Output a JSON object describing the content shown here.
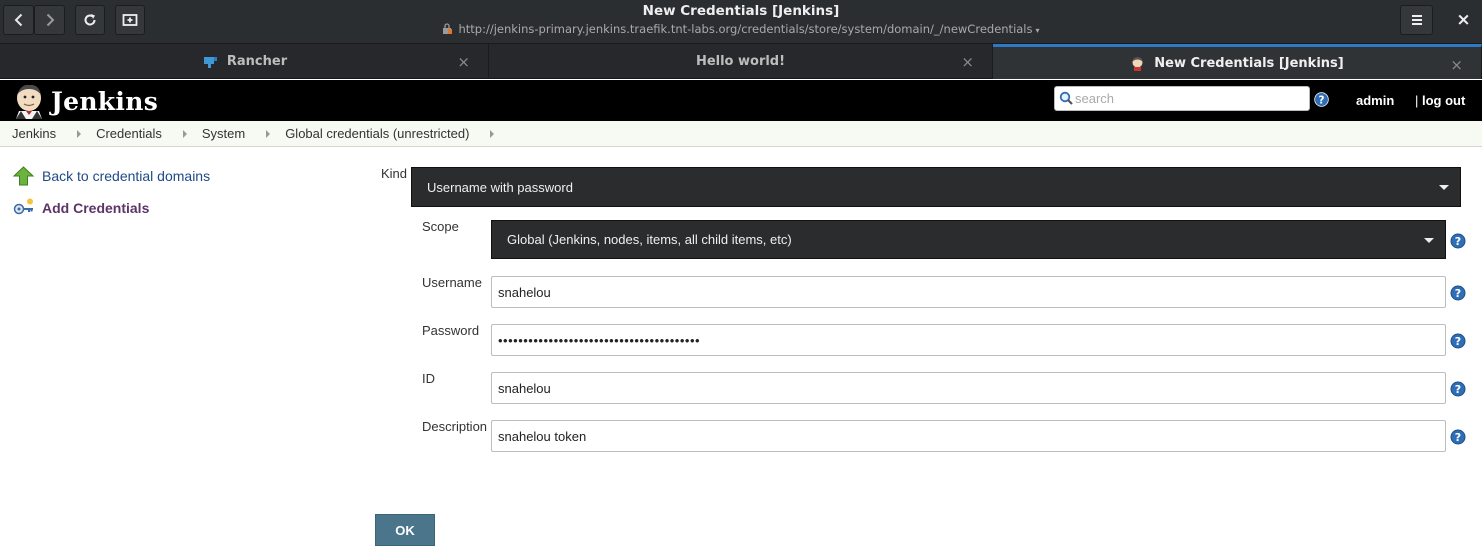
{
  "browser": {
    "window_title": "New Credentials [Jenkins]",
    "url": "http://jenkins-primary.jenkins.traefik.tnt-labs.org/credentials/store/system/domain/_/newCredentials",
    "url_dropdown": "▾",
    "tabs": [
      {
        "label": "Rancher",
        "close": "×"
      },
      {
        "label": "Hello world!",
        "close": "×"
      },
      {
        "label": "New Credentials [Jenkins]",
        "close": "×",
        "active": true
      }
    ],
    "menu_icon": "hamburger-icon",
    "close_icon": "×"
  },
  "jenkins": {
    "brand": "Jenkins",
    "search_placeholder": "search",
    "user": "admin",
    "separator": "|",
    "logout": "log out"
  },
  "breadcrumb": [
    "Jenkins",
    "Credentials",
    "System",
    "Global credentials (unrestricted)"
  ],
  "sidebar": {
    "items": [
      {
        "label": "Back to credential domains",
        "icon": "up-arrow-icon"
      },
      {
        "label": "Add Credentials",
        "icon": "key-icon"
      }
    ]
  },
  "form": {
    "kind_label": "Kind",
    "kind_value": "Username with password",
    "scope_label": "Scope",
    "scope_value": "Global (Jenkins, nodes, items, all child items, etc)",
    "username_label": "Username",
    "username_value": "snahelou",
    "password_label": "Password",
    "password_value": "••••••••••••••••••••••••••••••••••••••••",
    "id_label": "ID",
    "id_value": "snahelou",
    "description_label": "Description",
    "description_value": "snahelou token",
    "ok_label": "OK"
  },
  "colors": {
    "browser_chrome": "#2b2e31",
    "active_tab_accent": "#2f78c4",
    "jenkins_header": "#000000",
    "breadcrumb_bg": "#f6faf2",
    "link": "#204a87",
    "current_link": "#5c3566",
    "dark_select": "#2a2c2e",
    "ok_button": "#4b758b",
    "help_icon": "#2f6eb5"
  }
}
